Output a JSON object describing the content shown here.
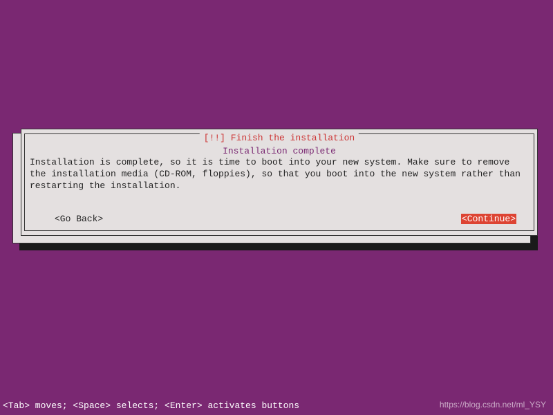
{
  "dialog": {
    "title": "[!!] Finish the installation",
    "subtitle": "Installation complete",
    "body": "Installation is complete, so it is time to boot into your new system. Make sure to remove the installation media (CD-ROM, floppies), so that you boot into the new system rather than restarting the installation.",
    "go_back_label": "<Go Back>",
    "continue_label": "<Continue>"
  },
  "statusbar": {
    "text": "<Tab> moves; <Space> selects; <Enter> activates buttons"
  },
  "watermark": {
    "text": "https://blog.csdn.net/ml_YSY"
  }
}
